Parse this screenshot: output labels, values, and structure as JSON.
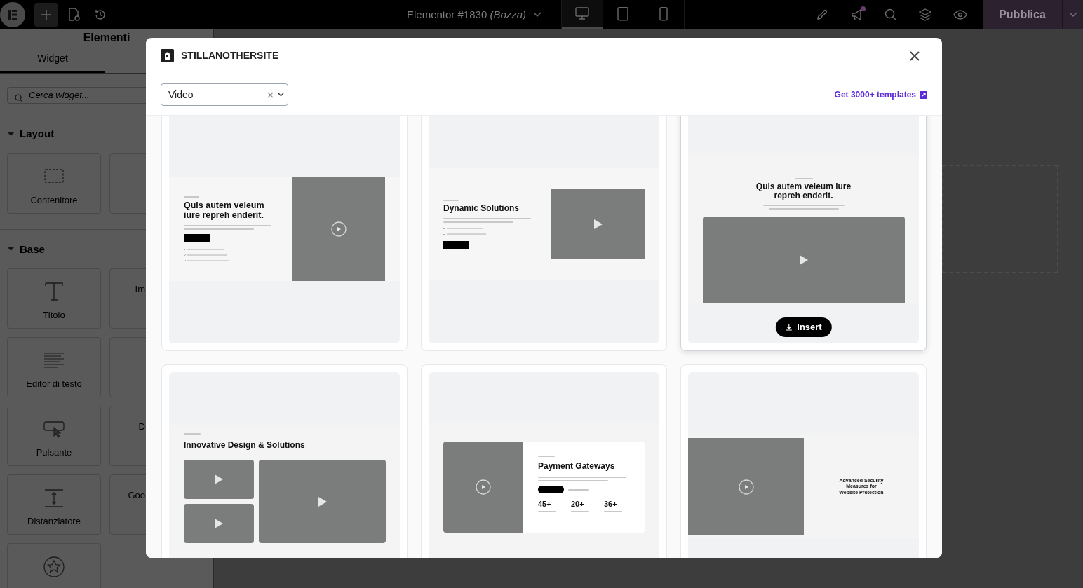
{
  "topbar": {
    "document_title": "Elementor #1830",
    "document_state": "(Bozza)",
    "devices": [
      {
        "kind": "desktop",
        "selected": true
      },
      {
        "kind": "tablet",
        "selected": false
      },
      {
        "kind": "mobile",
        "selected": false
      }
    ],
    "notification_dot": true,
    "publish_label": "Pubblica"
  },
  "sidebar": {
    "title": "Elementi",
    "tabs": [
      {
        "label": "Widget",
        "selected": true
      }
    ],
    "search_placeholder": "Cerca widget...",
    "sections": [
      {
        "title": "Layout",
        "expanded": true,
        "widgets": [
          {
            "kind": "container",
            "label": "Contenitore"
          },
          {
            "kind": "hidden"
          }
        ]
      },
      {
        "title": "Base",
        "expanded": true,
        "widgets": [
          {
            "kind": "heading",
            "label": "Titolo"
          },
          {
            "kind": "hidden",
            "label": "Im"
          },
          {
            "kind": "text",
            "label": "Editor di testo"
          },
          {
            "kind": "hidden"
          },
          {
            "kind": "button",
            "label": "Pulsante"
          },
          {
            "kind": "hidden",
            "label": "D"
          },
          {
            "kind": "spacer",
            "label": "Distanziatore"
          },
          {
            "kind": "hidden",
            "label": "Goo"
          },
          {
            "kind": "rating"
          }
        ]
      }
    ]
  },
  "modal": {
    "site_name": "STILLANOTHERSITE",
    "filter": {
      "value": "Video"
    },
    "promo_link": "Get 3000+ templates",
    "insert_label": "Insert",
    "templates": [
      {
        "kind": "split-list-below",
        "heading": "Quis autem veleum iure repreh enderit.",
        "selected": false
      },
      {
        "kind": "split-list-above",
        "heading": "Dynamic Solutions",
        "selected": false
      },
      {
        "kind": "centered-video",
        "heading": "Quis autem veleum iure repreh enderit.",
        "selected": true
      },
      {
        "kind": "video-grid",
        "heading": "Innovative Design & Solutions",
        "selected": false
      },
      {
        "kind": "stats",
        "heading": "Payment Gateways",
        "stats": [
          "45+",
          "20+",
          "36+"
        ],
        "selected": false
      },
      {
        "kind": "video-left",
        "heading": "Advanced Security Measures for Website Protection",
        "selected": false
      }
    ]
  }
}
